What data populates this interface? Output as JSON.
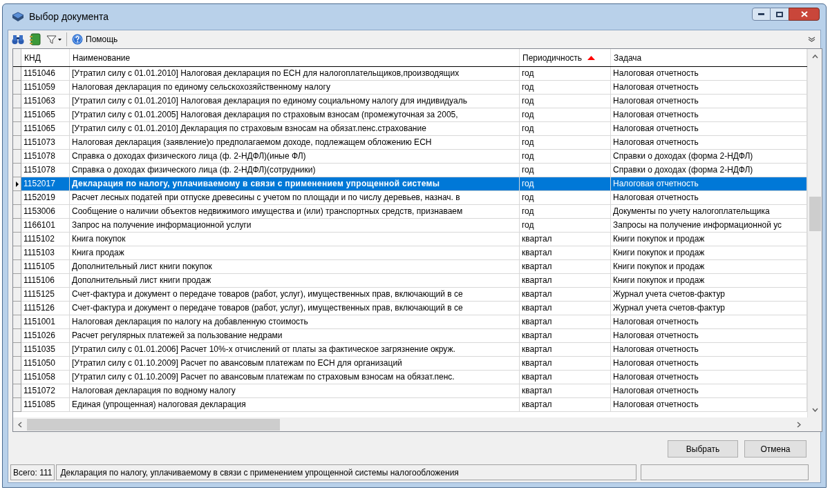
{
  "window": {
    "title": "Выбор документа"
  },
  "toolbar": {
    "help_label": "Помощь"
  },
  "table": {
    "columns": [
      {
        "label": "КНД",
        "sorted": false
      },
      {
        "label": "Наименование",
        "sorted": false
      },
      {
        "label": "Периодичность",
        "sorted": true
      },
      {
        "label": "Задача",
        "sorted": false
      }
    ],
    "rows": [
      {
        "cells": [
          "1151046",
          "[Утратил силу с 01.01.2010] Налоговая декларация по ЕСН для налогоплательщиков,производящих",
          "год",
          "Налоговая отчетность"
        ],
        "selected": false
      },
      {
        "cells": [
          "1151059",
          "Налоговая декларация по единому сельскохозяйственному налогу",
          "год",
          "Налоговая отчетность"
        ],
        "selected": false
      },
      {
        "cells": [
          "1151063",
          "[Утратил силу с 01.01.2010] Налоговая декларация по единому социальному налогу для индивидуаль",
          "год",
          "Налоговая отчетность"
        ],
        "selected": false
      },
      {
        "cells": [
          "1151065",
          "[Утратил силу с 01.01.2005] Налоговая декларация по страховым взносам (промежуточная за 2005,",
          "год",
          "Налоговая отчетность"
        ],
        "selected": false
      },
      {
        "cells": [
          "1151065",
          "[Утратил силу с 01.01.2010] Декларация по страховым взносам на обязат.пенс.страхование",
          "год",
          "Налоговая отчетность"
        ],
        "selected": false
      },
      {
        "cells": [
          "1151073",
          "Налоговая декларация (заявление)о предполагаемом доходе, подлежащем обложению ЕСН",
          "год",
          "Налоговая отчетность"
        ],
        "selected": false
      },
      {
        "cells": [
          "1151078",
          "Справка о доходах физического лица (ф. 2-НДФЛ)(иные ФЛ)",
          "год",
          "Справки о доходах (форма 2-НДФЛ)"
        ],
        "selected": false
      },
      {
        "cells": [
          "1151078",
          "Справка о доходах физического лица (ф. 2-НДФЛ)(сотрудники)",
          "год",
          "Справки о доходах (форма 2-НДФЛ)"
        ],
        "selected": false
      },
      {
        "cells": [
          "1152017",
          "Декларация по налогу, уплачиваемому в связи с применением упрощенной системы",
          "год",
          "Налоговая отчетность"
        ],
        "selected": true
      },
      {
        "cells": [
          "1152019",
          "Расчет лесных податей при отпуске древесины с учетом по площади и по числу деревьев, назнач. в",
          "год",
          "Налоговая отчетность"
        ],
        "selected": false
      },
      {
        "cells": [
          "1153006",
          "Сообщение о наличии объектов недвижимого имущества и (или) транспортных средств, признаваем",
          "год",
          "Документы по учету налогоплательщика"
        ],
        "selected": false
      },
      {
        "cells": [
          "1166101",
          "Запрос на получение информационной услуги",
          "год",
          "Запросы на получение информационной ус"
        ],
        "selected": false
      },
      {
        "cells": [
          "1115102",
          "Книга покупок",
          "квартал",
          "Книги покупок и продаж"
        ],
        "selected": false
      },
      {
        "cells": [
          "1115103",
          "Книга продаж",
          "квартал",
          "Книги покупок и продаж"
        ],
        "selected": false
      },
      {
        "cells": [
          "1115105",
          "Дополнительный лист книги покупок",
          "квартал",
          "Книги покупок и продаж"
        ],
        "selected": false
      },
      {
        "cells": [
          "1115106",
          "Дополнительный лист книги продаж",
          "квартал",
          "Книги покупок и продаж"
        ],
        "selected": false
      },
      {
        "cells": [
          "1115125",
          "Счет-фактура и документ о передаче товаров (работ, услуг), имущественных прав, включающий в се",
          "квартал",
          "Журнал учета счетов-фактур"
        ],
        "selected": false
      },
      {
        "cells": [
          "1115126",
          "Счет-фактура и документ о передаче товаров (работ, услуг), имущественных прав, включающий в се",
          "квартал",
          "Журнал учета счетов-фактур"
        ],
        "selected": false
      },
      {
        "cells": [
          "1151001",
          "Налоговая декларация по налогу на добавленную стоимость",
          "квартал",
          "Налоговая отчетность"
        ],
        "selected": false
      },
      {
        "cells": [
          "1151026",
          "Расчет регулярных платежей за пользование недрами",
          "квартал",
          "Налоговая отчетность"
        ],
        "selected": false
      },
      {
        "cells": [
          "1151035",
          "[Утратил силу с 01.01.2006] Расчет 10%-х отчислений от платы за фактическое загрязнение окруж.",
          "квартал",
          "Налоговая отчетность"
        ],
        "selected": false
      },
      {
        "cells": [
          "1151050",
          "[Утратил силу с 01.10.2009] Расчет по авансовым платежам по ЕСН для организаций",
          "квартал",
          "Налоговая отчетность"
        ],
        "selected": false
      },
      {
        "cells": [
          "1151058",
          "[Утратил силу с 01.10.2009] Расчет по авансовым платежам по страховым взносам на обязат.пенс.",
          "квартал",
          "Налоговая отчетность"
        ],
        "selected": false
      },
      {
        "cells": [
          "1151072",
          "Налоговая декларация по водному налогу",
          "квартал",
          "Налоговая отчетность"
        ],
        "selected": false
      },
      {
        "cells": [
          "1151085",
          "Единая (упрощенная) налоговая декларация",
          "квартал",
          "Налоговая отчетность"
        ],
        "selected": false
      }
    ]
  },
  "buttons": [
    {
      "label": "Выбрать"
    },
    {
      "label": "Отмена"
    }
  ],
  "status_bar": {
    "total": "Всего: 111",
    "description": "Декларация по налогу, уплачиваемому в связи с применением упрощенной системы налогообложения"
  }
}
